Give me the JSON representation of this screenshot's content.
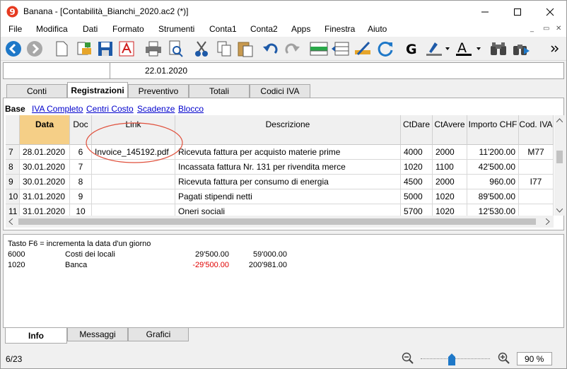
{
  "window": {
    "title": "Banana - [Contabilità_Bianchi_2020.ac2 (*)]"
  },
  "menu": [
    "File",
    "Modifica",
    "Dati",
    "Formato",
    "Strumenti",
    "Conta1",
    "Conta2",
    "Apps",
    "Finestra",
    "Aiuto"
  ],
  "formula_bar": {
    "value": "22.01.2020"
  },
  "tabs": [
    "Conti",
    "Registrazioni",
    "Preventivo",
    "Totali",
    "Codici IVA"
  ],
  "views": {
    "active": "Base",
    "links": [
      "IVA Completo",
      "Centri Costo",
      "Scadenze",
      "Blocco"
    ]
  },
  "columns": [
    "Data",
    "Doc",
    "Link",
    "Descrizione",
    "CtDare",
    "CtAvere",
    "Importo CHF",
    "Cod. IVA"
  ],
  "rows": [
    {
      "num": "7",
      "date": "28.01.2020",
      "doc": "6",
      "link": "Invoice_145192.pdf",
      "desc": "Ricevuta fattura per acquisto materie prime",
      "debit": "4000",
      "credit": "2000",
      "amount": "11'200.00",
      "vat": "M77"
    },
    {
      "num": "8",
      "date": "30.01.2020",
      "doc": "7",
      "link": "",
      "desc": "Incassata fattura Nr. 131 per rivendita merce",
      "debit": "1020",
      "credit": "1100",
      "amount": "42'500.00",
      "vat": ""
    },
    {
      "num": "9",
      "date": "30.01.2020",
      "doc": "8",
      "link": "",
      "desc": "Ricevuta fattura per consumo di energia",
      "debit": "4500",
      "credit": "2000",
      "amount": "960.00",
      "vat": "I77"
    },
    {
      "num": "10",
      "date": "31.01.2020",
      "doc": "9",
      "link": "",
      "desc": "Pagati stipendi netti",
      "debit": "5000",
      "credit": "1020",
      "amount": "89'500.00",
      "vat": ""
    },
    {
      "num": "11",
      "date": "31.01.2020",
      "doc": "10",
      "link": "",
      "desc": "Oneri sociali",
      "debit": "5700",
      "credit": "1020",
      "amount": "12'530.00",
      "vat": ""
    }
  ],
  "info": {
    "hint": "Tasto F6 = incrementa la data d'un giorno",
    "lines": [
      {
        "account": "6000",
        "name": "Costi dei locali",
        "movement": "29'500.00",
        "balance": "59'000.00",
        "negative": false
      },
      {
        "account": "1020",
        "name": "Banca",
        "movement": "-29'500.00",
        "balance": "200'981.00",
        "negative": true
      }
    ]
  },
  "bottom_tabs": [
    "Info",
    "Messaggi",
    "Grafici"
  ],
  "status": {
    "count": "6/23",
    "zoom": "90 %"
  },
  "colors": {
    "date_header": "#f5cf87",
    "negative": "#e00000",
    "annotation": "#e0503c",
    "link": "#0000cc"
  }
}
